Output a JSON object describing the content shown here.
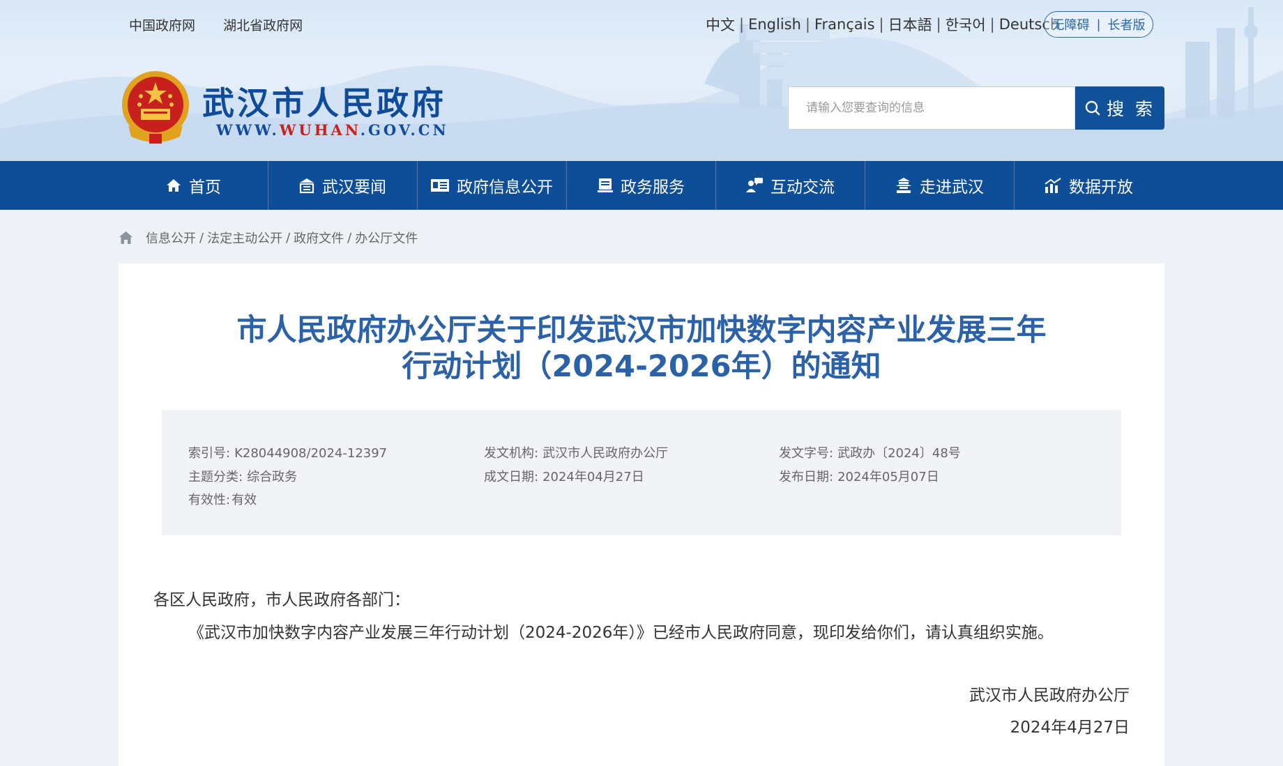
{
  "top_links": [
    "中国政府网",
    "湖北省政府网"
  ],
  "languages": [
    "中文",
    "English",
    "Français",
    "日本語",
    "한국어",
    "Deutsch"
  ],
  "accessibility": {
    "barrier_free": "无障碍",
    "elderly": "长者版"
  },
  "site": {
    "title": "武汉市人民政府",
    "url_prefix": "WWW.",
    "url_highlight": "WUHAN",
    "url_suffix": ".GOV.CN"
  },
  "search": {
    "placeholder": "请输入您要查询的信息",
    "button_label": "搜 索"
  },
  "nav": [
    {
      "label": "首页",
      "icon": "home-icon"
    },
    {
      "label": "武汉要闻",
      "icon": "news-icon"
    },
    {
      "label": "政府信息公开",
      "icon": "info-open-icon"
    },
    {
      "label": "政务服务",
      "icon": "service-icon"
    },
    {
      "label": "互动交流",
      "icon": "interaction-icon"
    },
    {
      "label": "走进武汉",
      "icon": "city-icon"
    },
    {
      "label": "数据开放",
      "icon": "data-chart-icon"
    }
  ],
  "breadcrumb": [
    "信息公开",
    "法定主动公开",
    "政府文件",
    "办公厅文件"
  ],
  "document": {
    "title_line1": "市人民政府办公厅关于印发武汉市加快数字内容产业发展三年",
    "title_line2": "行动计划（2024-2026年）的通知",
    "meta": {
      "index_label": "索引号:",
      "index_value": "K28044908/2024-12397",
      "issuer_label": "发文机构:",
      "issuer_value": "武汉市人民政府办公厅",
      "doc_no_label": "发文字号:",
      "doc_no_value": "武政办〔2024〕48号",
      "topic_label": "主题分类:",
      "topic_value": "综合政务",
      "created_label": "成文日期:",
      "created_value": "2024年04月27日",
      "published_label": "发布日期:",
      "published_value": "2024年05月07日",
      "validity_label": "有效性:",
      "validity_value": "有效"
    },
    "salutation": "各区人民政府，市人民政府各部门：",
    "paragraph": "《武汉市加快数字内容产业发展三年行动计划（2024-2026年）》已经市人民政府同意，现印发给你们，请认真组织实施。",
    "signature_org": "武汉市人民政府办公厅",
    "signature_date": "2024年4月27日"
  }
}
